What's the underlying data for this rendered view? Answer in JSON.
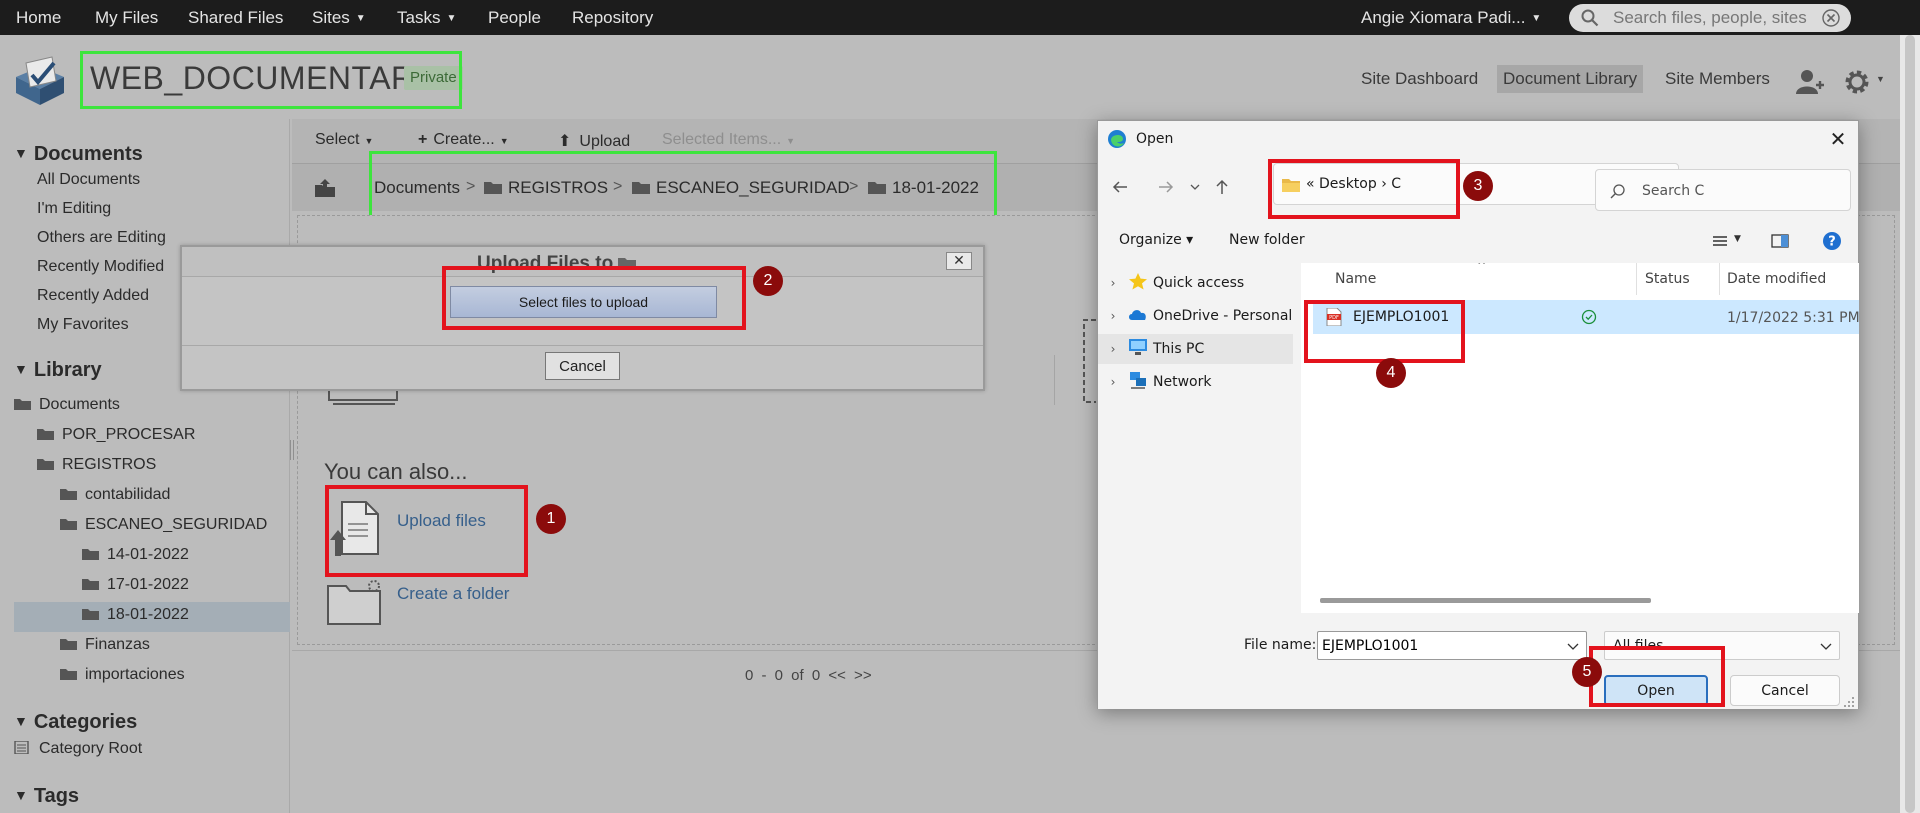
{
  "topnav": {
    "items": [
      "Home",
      "My Files",
      "Shared Files",
      "Sites",
      "Tasks",
      "People",
      "Repository"
    ],
    "user": "Angie Xiomara Padi...",
    "search_placeholder": "Search files, people, sites"
  },
  "site": {
    "title": "WEB_DOCUMENTARIA",
    "visibility": "Private",
    "nav": [
      "Site Dashboard",
      "Document Library",
      "Site Members"
    ]
  },
  "sidebar": {
    "documents_heading": "Documents",
    "document_links": [
      "All Documents",
      "I'm Editing",
      "Others are Editing",
      "Recently Modified",
      "Recently Added",
      "My Favorites"
    ],
    "library_heading": "Library",
    "tree": [
      "Documents",
      "POR_PROCESAR",
      "REGISTROS",
      "contabilidad",
      "ESCANEO_SEGURIDAD",
      "14-01-2022",
      "17-01-2022",
      "18-01-2022",
      "Finanzas",
      "importaciones"
    ],
    "categories_heading": "Categories",
    "category_root": "Category Root",
    "tags_heading": "Tags"
  },
  "toolbar": {
    "select": "Select",
    "create": "Create...",
    "upload": "Upload",
    "selected_items": "Selected Items..."
  },
  "breadcrumb": {
    "items": [
      "Documents",
      "REGISTROS",
      "ESCANEO_SEGURIDAD",
      "18-01-2022"
    ],
    "separator": ">"
  },
  "main": {
    "you_can_also": "You can also...",
    "upload_files": "Upload files",
    "create_folder": "Create a folder",
    "pager": "0 - 0 of 0 << >>"
  },
  "upload_dialog": {
    "title": "Upload Files to",
    "close": "✕",
    "select_button": "Select files to upload",
    "cancel": "Cancel"
  },
  "open_dialog": {
    "title": "Open",
    "close": "✕",
    "address": "«  Desktop  ›  C",
    "search_placeholder": "Search C",
    "organize": "Organize ▾",
    "new_folder": "New folder",
    "nav_tree": [
      "Quick access",
      "OneDrive - Personal",
      "This PC",
      "Network"
    ],
    "columns": [
      "Name",
      "Status",
      "Date modified"
    ],
    "file": {
      "name": "EJEMPLO1001",
      "date": "1/17/2022 5:31 PM"
    },
    "file_name_label": "File name:",
    "file_name_value": "EJEMPLO1001",
    "filter": "All files",
    "open_button": "Open",
    "cancel_button": "Cancel"
  },
  "annotations": [
    "1",
    "2",
    "3",
    "4",
    "5"
  ],
  "colors": {
    "highlight_red": "#e3131d",
    "highlight_green": "#3de53d",
    "badge": "#8b0b0b",
    "link": "#365f8b"
  }
}
